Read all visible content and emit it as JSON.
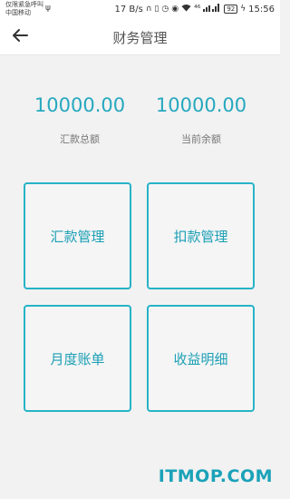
{
  "status_bar": {
    "carrier_line1": "仅限紧急呼叫",
    "carrier_line2": "中国移动",
    "net_speed": "17 B/s",
    "battery": "92",
    "time": "15:56",
    "signal_text": "⁴⁶"
  },
  "header": {
    "title": "财务管理"
  },
  "summary": [
    {
      "amount": "10000.00",
      "label": "汇款总额"
    },
    {
      "amount": "10000.00",
      "label": "当前余额"
    }
  ],
  "menu": [
    {
      "label": "汇款管理"
    },
    {
      "label": "扣款管理"
    },
    {
      "label": "月度账单"
    },
    {
      "label": "收益明细"
    }
  ],
  "watermark": "ITMOP.COM",
  "colors": {
    "accent": "#26a8bf",
    "card_border": "#26b3c7",
    "background": "#f2f2f2"
  }
}
